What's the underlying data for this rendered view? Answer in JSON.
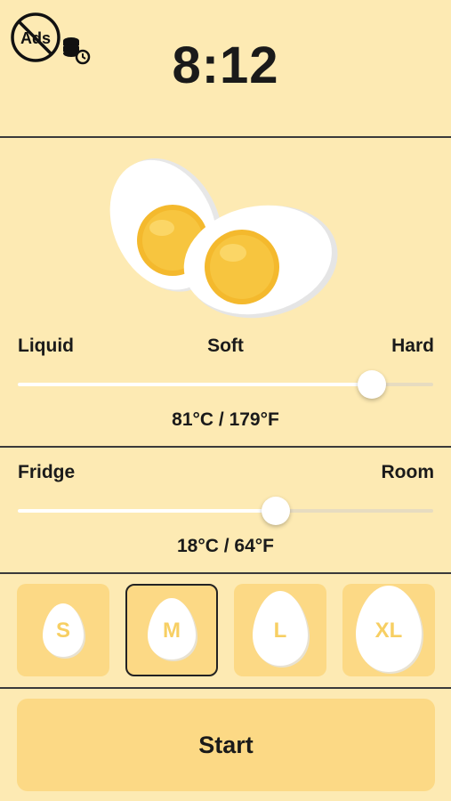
{
  "header": {
    "time": "8:12",
    "ads_badge_text": "Ads"
  },
  "doneness": {
    "labels": [
      "Liquid",
      "Soft",
      "Hard"
    ],
    "level": 0.853,
    "value_text": "81°C / 179°F"
  },
  "start_temp": {
    "labels": [
      "Fridge",
      "Room"
    ],
    "level": 0.62,
    "value_text": "18°C / 64°F"
  },
  "sizes": {
    "options": [
      "S",
      "M",
      "L",
      "XL"
    ],
    "selected": "M"
  },
  "start_label": "Start",
  "colors": {
    "background": "#fdeab3",
    "tile": "#fcd985",
    "yolk": "#f4b92d",
    "letter": "#f7cf63"
  }
}
